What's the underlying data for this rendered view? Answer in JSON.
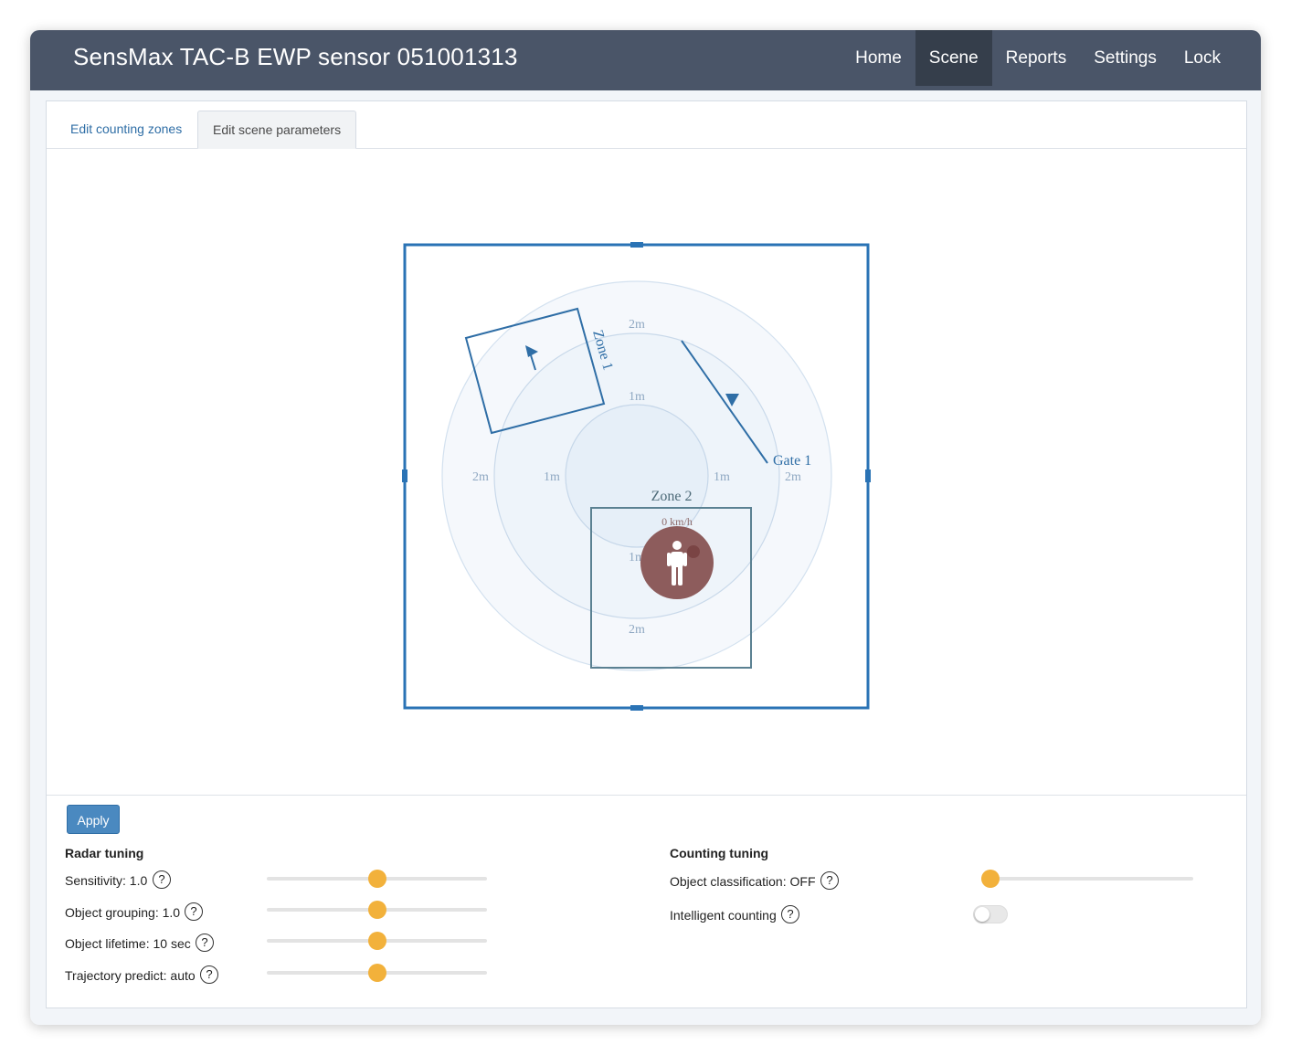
{
  "app": {
    "title": "SensMax TAC-B EWP sensor 051001313"
  },
  "nav": {
    "items": [
      {
        "label": "Home",
        "active": false
      },
      {
        "label": "Scene",
        "active": true
      },
      {
        "label": "Reports",
        "active": false
      },
      {
        "label": "Settings",
        "active": false
      },
      {
        "label": "Lock",
        "active": false
      }
    ]
  },
  "tabs": [
    {
      "label": "Edit counting zones",
      "active": false
    },
    {
      "label": "Edit scene parameters",
      "active": true
    }
  ],
  "scene": {
    "ring_labels": {
      "outer": "2m",
      "inner": "1m"
    },
    "zone1_label": "Zone 1",
    "zone2_label": "Zone 2",
    "gate_label": "Gate 1",
    "speed_label": "0 km/h",
    "colors": {
      "frame": "#2a73b5",
      "zone": "#2f6ea6",
      "zone2": "#5b8192",
      "ring_fill": "#eef4fa",
      "target": "#8d5c5c"
    }
  },
  "controls": {
    "apply_label": "Apply",
    "radar": {
      "title": "Radar tuning",
      "params": [
        {
          "label": "Sensitivity: 1.0",
          "level": 0.5
        },
        {
          "label": "Object grouping: 1.0",
          "level": 0.5
        },
        {
          "label": "Object lifetime: 10 sec",
          "level": 0.5
        },
        {
          "label": "Trajectory predict: auto",
          "level": 0.5
        }
      ]
    },
    "counting": {
      "title": "Counting tuning",
      "classification": {
        "label": "Object classification: OFF",
        "level": 0.0
      },
      "intelligent": {
        "label": "Intelligent counting",
        "enabled": false
      }
    },
    "help_glyph": "?"
  },
  "icons": {
    "help": "question-circle-icon",
    "person": "person-icon",
    "direction": "arrow-up-icon",
    "gate_direction": "triangle-down-icon"
  }
}
